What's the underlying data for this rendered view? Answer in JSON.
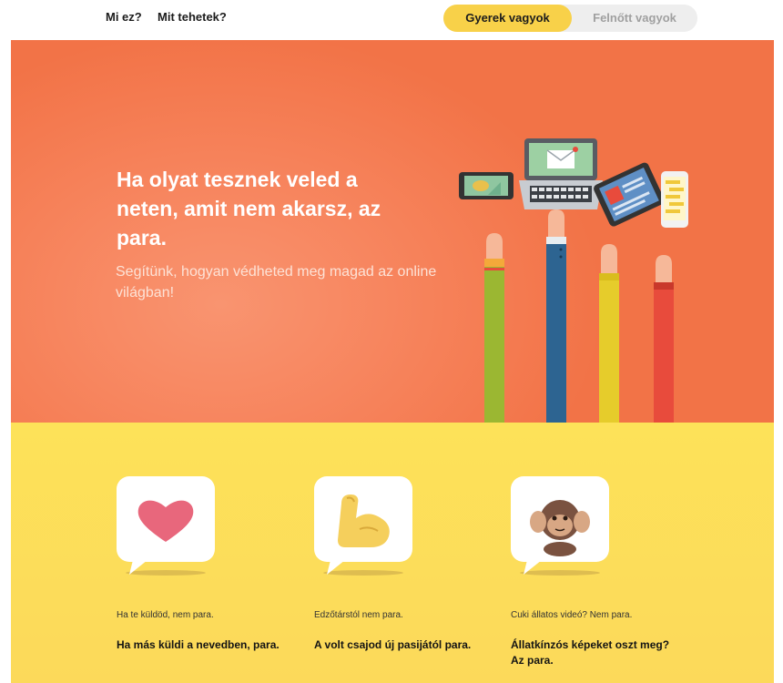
{
  "nav": {
    "links": [
      "Mi ez?",
      "Mit tehetek?"
    ],
    "toggle": {
      "active": "Gyerek vagyok",
      "inactive": "Felnőtt vagyok"
    }
  },
  "hero": {
    "title": "Ha olyat tesznek veled a neten, amit nem akarsz, az para.",
    "subtitle": "Segítünk, hogyan védheted meg magad az online világban!",
    "illustration": "hands-holding-devices"
  },
  "cards": [
    {
      "icon": "heart-icon",
      "light": "Ha te küldöd, nem para.",
      "bold": "Ha más küldi a nevedben, para."
    },
    {
      "icon": "flexed-arm-icon",
      "light": "Edzőtárstól nem para.",
      "bold": "A volt csajod új pasijától para."
    },
    {
      "icon": "hear-no-evil-monkey-icon",
      "light": "Cuki állatos videó? Nem para.",
      "bold": "Állatkínzós képeket oszt meg? Az para."
    }
  ],
  "colors": {
    "hero": "#f27347",
    "cards_bg": "#fcd95a",
    "toggle_active": "#f8d149"
  }
}
